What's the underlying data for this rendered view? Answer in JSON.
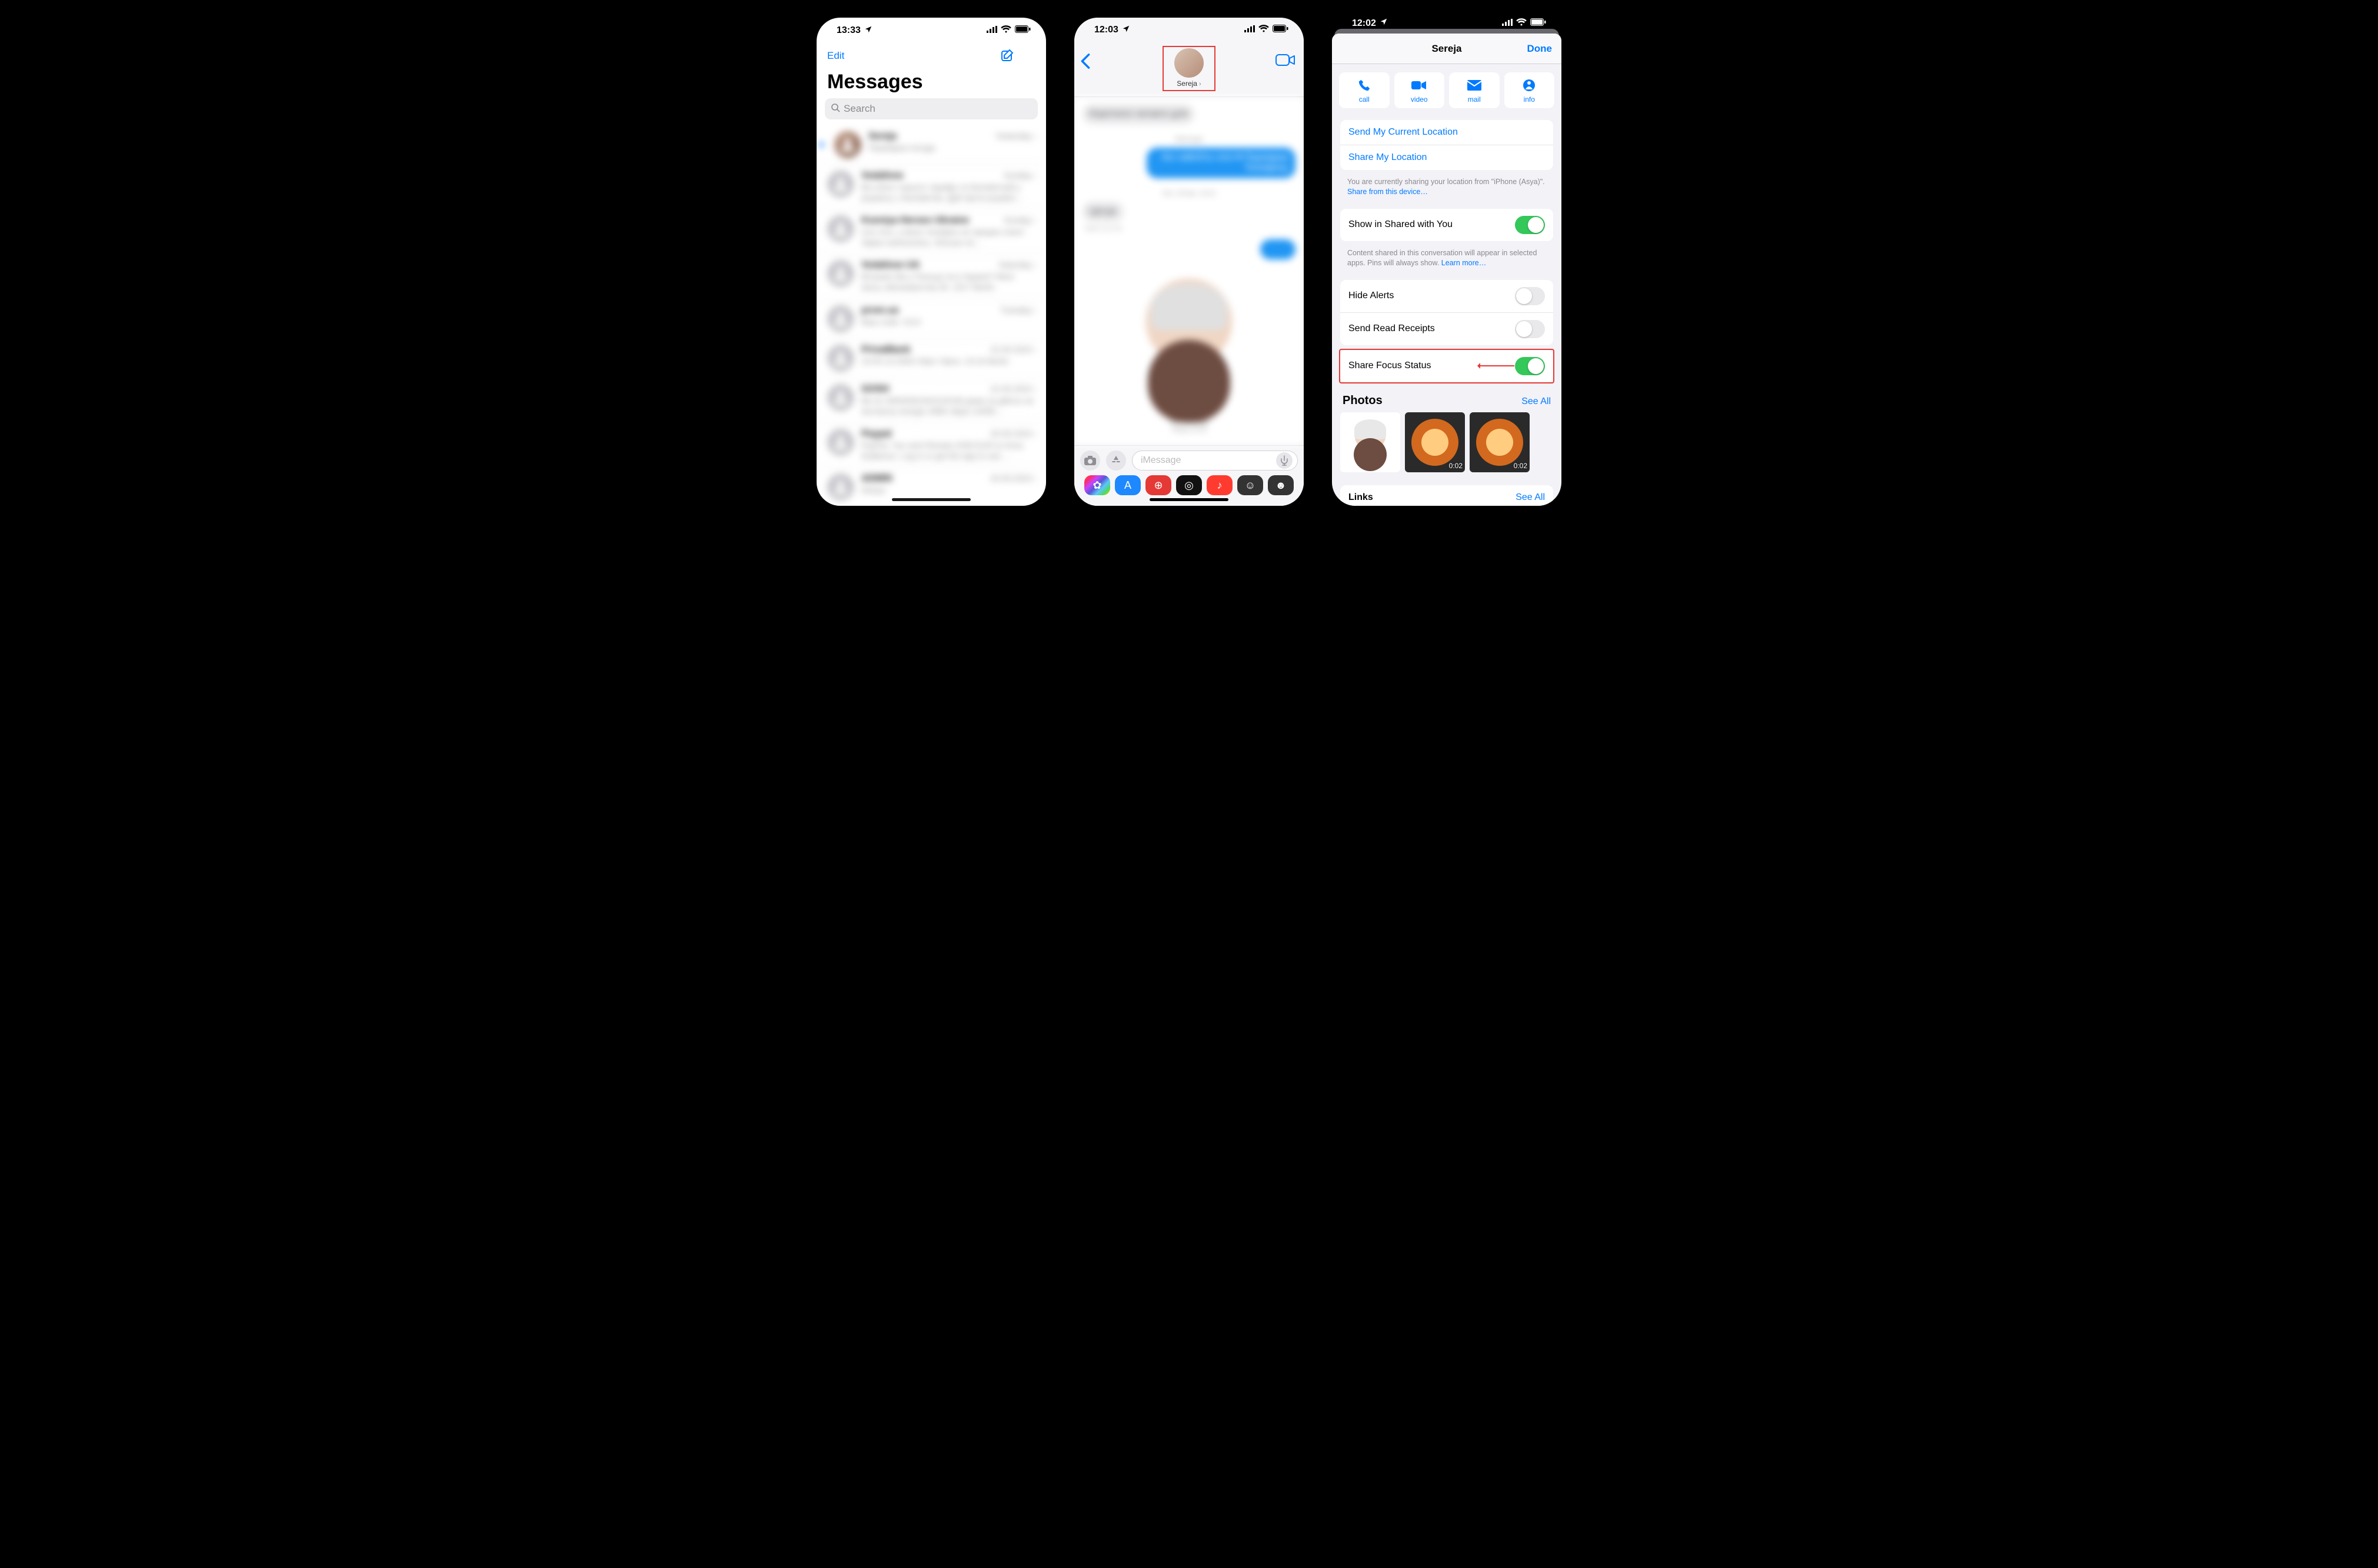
{
  "phone1": {
    "time": "13:33",
    "edit": "Edit",
    "title": "Messages",
    "search_placeholder": "Search",
    "conversations": [
      {
        "name": "Sereja",
        "time": "Yesterday",
        "preview": "Перевірка погоди"
      },
      {
        "name": "Vodafone",
        "time": "Sunday",
        "preview": "Ви клієнт нашого тарифу та безлімітний у роумінгу з безлімітом. Дуй проти роумінг…"
      },
      {
        "name": "Kseniya Heroes Ukraine",
        "time": "Sunday",
        "preview": "Ало Ася, у мене телефон не працює ключ! Зараз написались. Більше не…"
      },
      {
        "name": "Vodafone UA",
        "time": "Saturday",
        "preview": "Вітаємо! Ви у Польщі чи в Україні? Мені якось абонементом 26. 1517 Berlin. Телефон…"
      },
      {
        "name": "prom.ua",
        "time": "Tuesday",
        "preview": "Ваш code: 2113"
      },
      {
        "name": "PrivatBank",
        "time": "22.05.2023",
        "preview": "19.05.14.2009 Vitaiv Yakov. 15:24 Berlin"
      },
      {
        "name": "GOSH",
        "time": "22.05.2023",
        "preview": "Ви не 26000302320120158 дома за дійсно не експанлу energiu 2666 лівую 10456.…"
      },
      {
        "name": "Paypal",
        "time": "20.05.2023",
        "preview": "PayPal. You sent Renata 2258 EUR to Anna Dublence. Log in or get the app to see …"
      },
      {
        "name": "ADMIN",
        "time": "20.05.2023",
        "preview": "Dariya"
      }
    ],
    "unread_index": 0
  },
  "phone2": {
    "time": "12:03",
    "contact_name": "Sereja",
    "imessage_placeholder": "iMessage",
    "timestamp_label": "iMessage",
    "date_label": "Sun. 28 Apr. 10:31",
    "app_strip": [
      "photos",
      "appstore",
      "memoji-red",
      "activity",
      "music",
      "memoji1",
      "memoji2"
    ]
  },
  "phone3": {
    "time": "12:02",
    "title": "Sereja",
    "done": "Done",
    "actions": {
      "call": "call",
      "video": "video",
      "mail": "mail",
      "info": "info"
    },
    "location": {
      "send_current": "Send My Current Location",
      "share": "Share My Location",
      "footer_pre": "You are currently sharing your location from \"iPhone (Asya)\". ",
      "footer_link": "Share from this device…"
    },
    "shared": {
      "label": "Show in Shared with You",
      "on": true,
      "footer_pre": "Content shared in this conversation will appear in selected apps. Pins will always show. ",
      "footer_link": "Learn more…"
    },
    "toggles": {
      "hide_alerts": {
        "label": "Hide Alerts",
        "on": false
      },
      "read_receipts": {
        "label": "Send Read Receipts",
        "on": false
      },
      "focus": {
        "label": "Share Focus Status",
        "on": true
      }
    },
    "photos": {
      "label": "Photos",
      "see_all": "See All",
      "items": [
        {
          "kind": "memoji",
          "duration": ""
        },
        {
          "kind": "lion",
          "duration": "0:02"
        },
        {
          "kind": "lion",
          "duration": "0:02"
        }
      ]
    },
    "links": {
      "label": "Links",
      "see_all": "See All"
    }
  }
}
